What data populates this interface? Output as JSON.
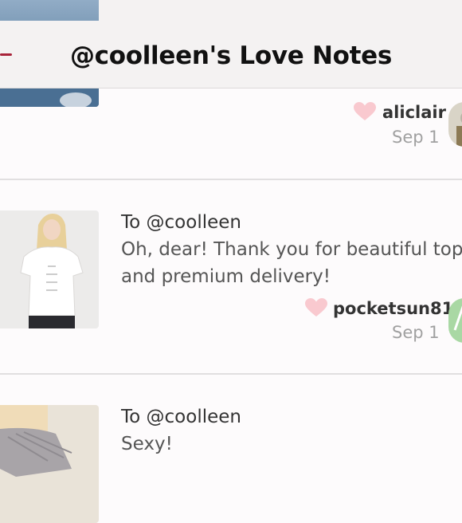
{
  "status_bar": {
    "text": "lock"
  },
  "nav": {
    "title": "@coolleen's Love Notes"
  },
  "notes": [
    {
      "username": "aliclair",
      "date": "Sep 1"
    },
    {
      "to": "To @coolleen",
      "message": "Oh, dear! Thank you for beautiful top and premium delivery!",
      "username": "pocketsun81",
      "date": "Sep 1"
    },
    {
      "to": "To @coolleen",
      "message": "Sexy!"
    }
  ],
  "colors": {
    "heart": "#f9c9cf",
    "accent": "#a8243a",
    "avatar_green": "#a9d8a4"
  }
}
